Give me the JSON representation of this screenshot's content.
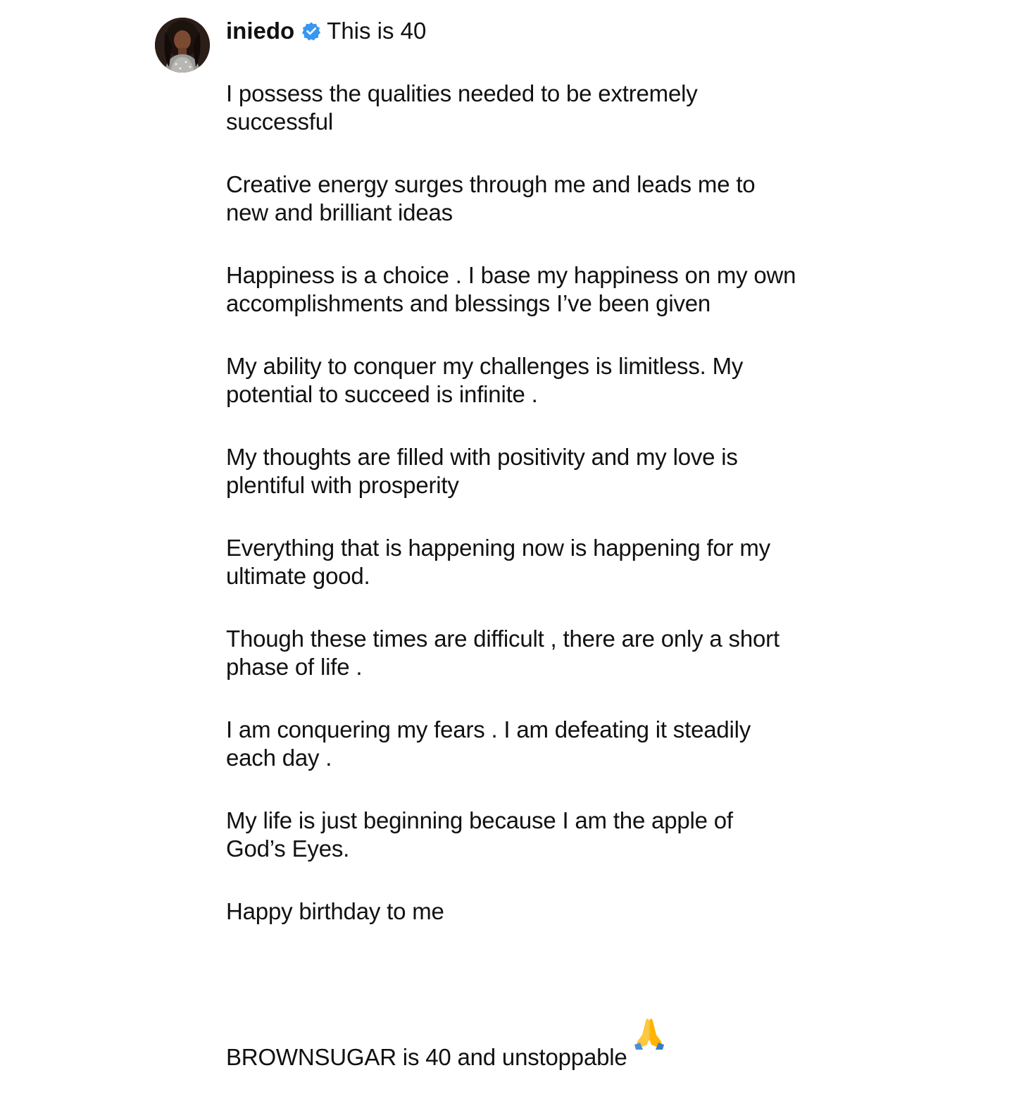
{
  "post": {
    "username": "iniedo",
    "verified_icon": "verified-badge-icon",
    "verified_color": "#3897f0",
    "headline": "This is 40",
    "paragraphs": [
      "I possess the qualities needed to be extremely\nsuccessful",
      "Creative energy surges through me and leads me to\nnew and brilliant ideas",
      "Happiness is a choice . I base my happiness on my own\naccomplishments and blessings I’ve been given",
      "My ability to conquer my challenges is limitless. My\npotential to succeed is infinite .",
      "My thoughts are filled with positivity and my love is\nplentiful with prosperity",
      "Everything that is happening now is happening for my\nultimate good.",
      "Though these times are difficult , there are only a short\nphase of life .",
      "I am conquering my fears . I am defeating it steadily\neach day .",
      "My life is just beginning because I am the apple of\nGod’s Eyes.",
      "Happy birthday to me"
    ],
    "last_paragraph": "BROWNSUGAR is 40 and unstoppable",
    "last_emoji": "folded-hands-icon"
  }
}
